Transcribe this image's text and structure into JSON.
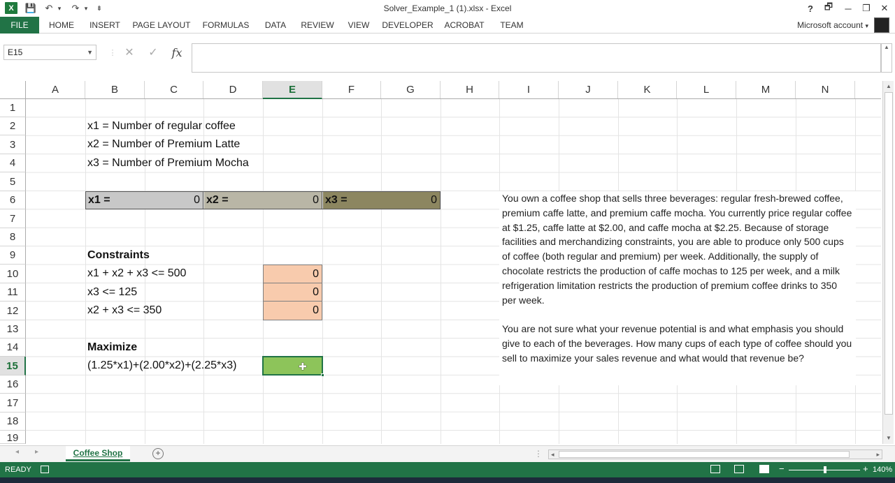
{
  "window": {
    "title": "Solver_Example_1 (1).xlsx - Excel",
    "logo_letter": "X",
    "help": "?",
    "minimize": "─",
    "maximize": "❐",
    "close": "✕",
    "restore": "🗗"
  },
  "qat": {
    "save": "💾",
    "undo": "↶",
    "undo_dd": "▾",
    "redo": "↷",
    "redo_dd": "▾",
    "customize": "⇟"
  },
  "ribbon": {
    "tabs": [
      "FILE",
      "HOME",
      "INSERT",
      "PAGE LAYOUT",
      "FORMULAS",
      "DATA",
      "REVIEW",
      "VIEW",
      "DEVELOPER",
      "ACROBAT",
      "TEAM"
    ],
    "account": "Microsoft account",
    "account_dd": "▾"
  },
  "formula_bar": {
    "namebox": "E15",
    "cancel": "✕",
    "enter": "✓",
    "fx": "fx",
    "value": ""
  },
  "columns": [
    "A",
    "B",
    "C",
    "D",
    "E",
    "F",
    "G",
    "H",
    "I",
    "J",
    "K",
    "L",
    "M",
    "N"
  ],
  "rows": [
    "1",
    "2",
    "3",
    "4",
    "5",
    "6",
    "7",
    "8",
    "9",
    "10",
    "11",
    "12",
    "13",
    "14",
    "15",
    "16",
    "17",
    "18",
    "19"
  ],
  "cells": {
    "B2": "x1 = Number of regular coffee",
    "B3": "x2 = Number of Premium Latte",
    "B4": "x3 = Number of Premium Mocha",
    "B6": "x1 =",
    "C6": "0",
    "D6": "x2 =",
    "E6": "0",
    "F6": "x3 =",
    "G6": "0",
    "B9": "Constraints",
    "B10": "x1 + x2 + x3 <= 500",
    "E10": "0",
    "B11": "x3 <= 125",
    "E11": "0",
    "B12": "x2 + x3 <= 350",
    "E12": "0",
    "B14": "Maximize",
    "B15": "(1.25*x1)+(2.00*x2)+(2.25*x3)"
  },
  "description": {
    "p1": "You own a coffee shop that sells three beverages: regular fresh-brewed coffee, premium caffe latte, and premium caffe mocha. You currently price regular coffee at $1.25, caffe latte at $2.00, and caffe mocha at $2.25. Because of storage facilities and merchandizing constraints, you are able to produce only 500 cups of coffee (both regular and premium) per week. Additionally, the supply of chocolate restricts the production of caffe mochas to 125 per week, and a milk refrigeration limitation restricts the production of premium coffee drinks to 350 per week.",
    "p2": "You are not sure what your revenue potential is and what emphasis you should give to each of the beverages. How many cups of each type of coffee should you sell to maximize your sales revenue and what would that revenue be?"
  },
  "sheets": {
    "active": "Coffee Shop",
    "add": "+",
    "prev": "◂",
    "next": "▸"
  },
  "status": {
    "ready": "READY",
    "zoom": "140%",
    "zoom_out": "−",
    "zoom_in": "+"
  },
  "scroll": {
    "up": "▲",
    "down": "▼",
    "left": "◂",
    "right": "▸"
  },
  "colors": {
    "accent": "#217346",
    "orange_cell": "#f8cbad",
    "green_cell": "#8dc45a"
  }
}
